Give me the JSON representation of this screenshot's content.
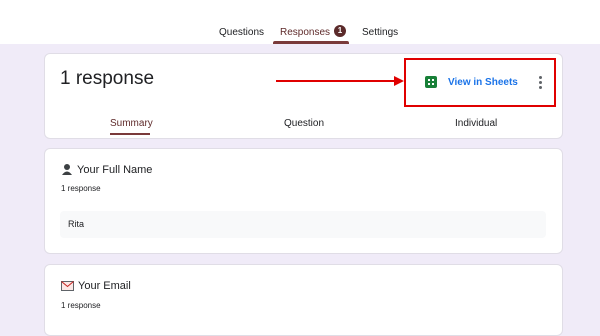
{
  "nav": {
    "tabs": [
      {
        "label": "Questions"
      },
      {
        "label": "Responses",
        "badge": "1"
      },
      {
        "label": "Settings"
      }
    ],
    "active_tab": "Responses"
  },
  "summary_card": {
    "title": "1 response",
    "view_in_sheets_label": "View in Sheets",
    "subtabs": [
      {
        "label": "Summary"
      },
      {
        "label": "Question"
      },
      {
        "label": "Individual"
      }
    ],
    "active_subtab": "Summary"
  },
  "questions": [
    {
      "title": "Your Full Name",
      "icon": "person-icon",
      "count": "1 response",
      "answer": "Rita"
    },
    {
      "title": "Your Email",
      "icon": "email-icon",
      "count": "1 response"
    }
  ],
  "colors": {
    "accent": "#7a3a3a",
    "background": "#f0ebf8",
    "sheets_green": "#188038",
    "link_blue": "#1a73e8",
    "highlight_red": "#e00000"
  }
}
